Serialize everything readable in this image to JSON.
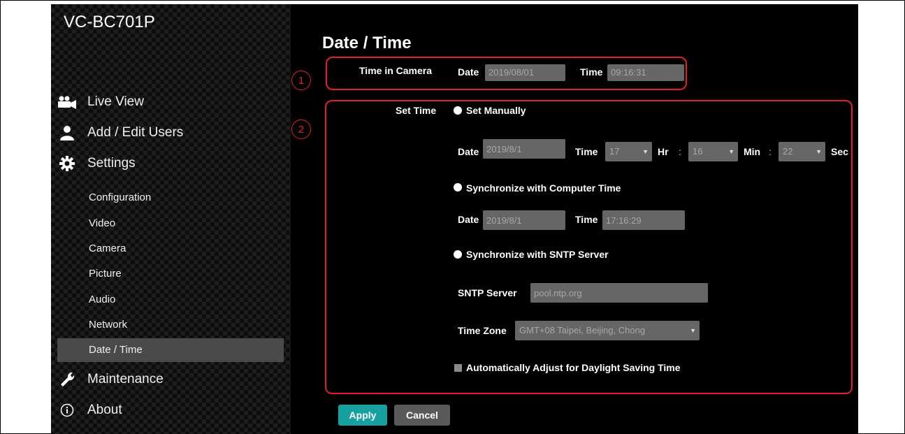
{
  "sidebar": {
    "model": "VC-BC701P",
    "main_items": [
      {
        "label": "Live View",
        "icon": "video-camera-icon"
      },
      {
        "label": "Add / Edit Users",
        "icon": "user-icon"
      },
      {
        "label": "Settings",
        "icon": "gear-icon"
      }
    ],
    "sub_items": [
      "Configuration",
      "Video",
      "Camera",
      "Picture",
      "Audio",
      "Network",
      "Date / Time"
    ],
    "active_sub": "Date / Time",
    "bottom_items": [
      {
        "label": "Maintenance",
        "icon": "wrench-icon"
      },
      {
        "label": "About",
        "icon": "info-icon"
      }
    ]
  },
  "main": {
    "title": "Date / Time",
    "time_in_camera": {
      "label": "Time in Camera",
      "date_label": "Date",
      "date_value": "2019/08/01",
      "time_label": "Time",
      "time_value": "09:16:31"
    },
    "set_time": {
      "label": "Set Time",
      "manual": {
        "label": "Set Manually",
        "date_label": "Date",
        "date_value": "2019/8/1",
        "time_label": "Time",
        "hour": "17",
        "hr_label": "Hr",
        "sep": ":",
        "minute": "16",
        "min_label": "Min",
        "second": "22",
        "sec_label": "Sec"
      },
      "computer": {
        "label": "Synchronize with Computer Time",
        "date_label": "Date",
        "date_value": "2019/8/1",
        "time_label": "Time",
        "time_value": "17:16:29"
      },
      "sntp": {
        "label": "Synchronize with SNTP Server",
        "server_label": "SNTP Server",
        "server_value": "pool.ntp.org",
        "timezone_label": "Time Zone",
        "timezone_value": "GMT+08 Taipei, Beijing, Chong"
      },
      "dst_label": "Automatically Adjust for Daylight Saving Time"
    },
    "apply_label": "Apply",
    "cancel_label": "Cancel"
  },
  "annotations": {
    "callout_1": "1",
    "callout_2": "2",
    "color": "#e3202a"
  },
  "colors": {
    "accent": "#16a1a0",
    "active_nav": "#4a4a4a",
    "field_bg": "#666666"
  }
}
